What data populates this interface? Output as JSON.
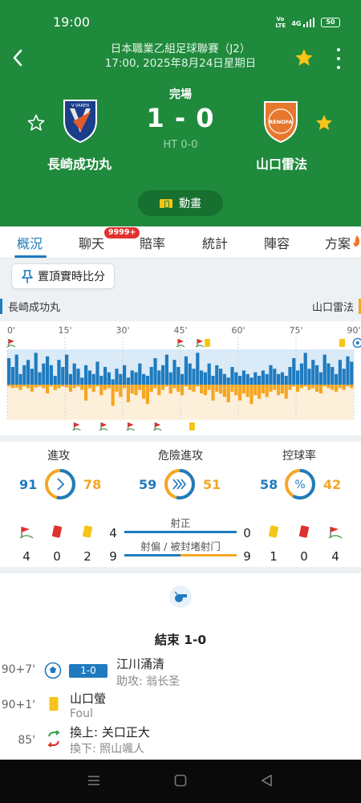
{
  "status_bar": {
    "time": "19:00",
    "volte": "Vo LTE",
    "network": "4G",
    "battery": "50"
  },
  "header": {
    "league": "日本職業乙組足球聯賽（J2）",
    "datetime": "17:00, 2025年8月24日星期日",
    "match_status": "完場",
    "score": "1 - 0",
    "half_time": "HT 0-0",
    "home_team": "長崎成功丸",
    "away_team": "山口雷法",
    "home_logo_text": "V·VAREN",
    "away_logo_text": "RENOFA",
    "animation_label": "動畫"
  },
  "tabs": [
    {
      "label": "概況",
      "active": true
    },
    {
      "label": "聊天",
      "active": false
    },
    {
      "label": "賠率",
      "active": false
    },
    {
      "label": "統計",
      "active": false
    },
    {
      "label": "陣容",
      "active": false
    },
    {
      "label": "方案",
      "active": false
    }
  ],
  "chat_badge": "9999+",
  "pin_label": "置頂實時比分",
  "momentum": {
    "home_label": "長崎成功丸",
    "away_label": "山口雷法",
    "ticks": [
      "0'",
      "15'",
      "30'",
      "45'",
      "60'",
      "75'",
      "90'"
    ],
    "home": [
      0.75,
      0.5,
      0.85,
      0.3,
      0.55,
      0.7,
      0.45,
      0.9,
      0.35,
      0.6,
      0.8,
      0.55,
      0.25,
      0.7,
      0.5,
      0.85,
      0.3,
      0.6,
      0.45,
      0.2,
      0.55,
      0.4,
      0.3,
      0.65,
      0.25,
      0.5,
      0.35,
      0.15,
      0.45,
      0.3,
      0.55,
      0.2,
      0.4,
      0.35,
      0.6,
      0.3,
      0.25,
      0.5,
      0.75,
      0.4,
      0.55,
      0.85,
      0.35,
      0.7,
      0.5,
      0.3,
      0.8,
      0.6,
      0.45,
      0.9,
      0.4,
      0.35,
      0.6,
      0.25,
      0.55,
      0.45,
      0.3,
      0.2,
      0.5,
      0.35,
      0.25,
      0.4,
      0.3,
      0.2,
      0.35,
      0.25,
      0.4,
      0.3,
      0.55,
      0.45,
      0.3,
      0.35,
      0.25,
      0.5,
      0.75,
      0.4,
      0.6,
      0.9,
      0.45,
      0.7,
      0.55,
      0.35,
      0.85,
      0.6,
      0.5,
      0.3,
      0.7,
      0.45,
      0.8,
      0.65
    ],
    "away": [
      0.05,
      0.1,
      0.08,
      0.15,
      0.05,
      0.1,
      0.2,
      0.08,
      0.05,
      0.1,
      0.25,
      0.05,
      0.15,
      0.1,
      0.05,
      0.08,
      0.2,
      0.1,
      0.05,
      0.15,
      0.45,
      0.1,
      0.2,
      0.05,
      0.3,
      0.15,
      0.1,
      0.6,
      0.2,
      0.35,
      0.1,
      0.5,
      0.25,
      0.3,
      0.15,
      0.4,
      0.55,
      0.2,
      0.1,
      0.3,
      0.15,
      0.05,
      0.25,
      0.1,
      0.2,
      0.3,
      0.05,
      0.15,
      0.2,
      0.05,
      0.25,
      0.3,
      0.15,
      0.45,
      0.2,
      0.25,
      0.35,
      0.5,
      0.2,
      0.3,
      0.45,
      0.25,
      0.35,
      0.55,
      0.3,
      0.4,
      0.25,
      0.35,
      0.2,
      0.15,
      0.3,
      0.25,
      0.4,
      0.15,
      0.05,
      0.2,
      0.1,
      0.05,
      0.15,
      0.1,
      0.2,
      0.25,
      0.05,
      0.1,
      0.15,
      0.2,
      0.1,
      0.15,
      0.05,
      0.1
    ],
    "home_events": [
      {
        "minute": 1,
        "type": "corner"
      },
      {
        "minute": 45,
        "type": "corner"
      },
      {
        "minute": 50,
        "type": "corner"
      },
      {
        "minute": 52,
        "type": "yellow"
      },
      {
        "minute": 87,
        "type": "yellow"
      },
      {
        "minute": 91,
        "type": "goal"
      }
    ],
    "away_events": [
      {
        "minute": 18,
        "type": "corner"
      },
      {
        "minute": 25,
        "type": "corner"
      },
      {
        "minute": 32,
        "type": "corner"
      },
      {
        "minute": 39,
        "type": "corner"
      },
      {
        "minute": 48,
        "type": "yellow"
      }
    ],
    "colors": {
      "home": "#1f7bbf",
      "away": "#f5a623"
    }
  },
  "stats": {
    "attack": {
      "label": "進攻",
      "home": 91,
      "away": 78
    },
    "dangerous": {
      "label": "危險進攻",
      "home": 59,
      "away": 51
    },
    "possession": {
      "label": "控球率",
      "home": 58,
      "away": 42
    },
    "home_counts": {
      "corners": "4",
      "red": "0",
      "yellow": "2"
    },
    "away_counts": {
      "corners": "4",
      "red": "0",
      "yellow": "1"
    },
    "on_target": {
      "label": "射正",
      "home": 4,
      "away": 0
    },
    "off_target": {
      "label": "射偏 / 被封堵射门",
      "home": 9,
      "away": 9
    }
  },
  "timeline": {
    "title": "結束 1-0",
    "events": [
      {
        "minute": "90+7'",
        "type": "goal",
        "score": "1-0",
        "main": "江川涌清",
        "sub": "助攻: 翁长圣"
      },
      {
        "minute": "90+1'",
        "type": "yellow",
        "main": "山口螢",
        "sub": "Foul"
      },
      {
        "minute": "85'",
        "type": "substitution",
        "main": "換上: 关口正大",
        "sub": "換下: 照山颯人"
      }
    ]
  }
}
